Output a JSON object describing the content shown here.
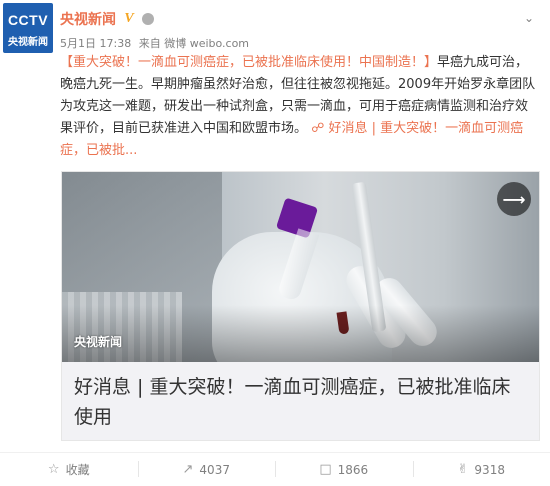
{
  "account": {
    "avatar_logo": "CCTV",
    "avatar_name": "央视新闻",
    "name": "央视新闻",
    "verified_mark": "V"
  },
  "meta": {
    "time": "5月1日 17:38",
    "source": "来自 微博 weibo.com"
  },
  "post": {
    "hashtag": "【重大突破！一滴血可测癌症，已被批准临床使用！中国制造！】",
    "body": "早癌九成可治，晚癌九死一生。早期肿瘤虽然好治愈，但往往被忽视拖延。2009年开始罗永章团队为攻克这一难题，研发出一种试剂盒，只需一滴血，可用于癌症病情监测和治疗效果评价，目前已获准进入中国和欧盟市场。",
    "link_text": "好消息 | 重大突破！一滴血可测癌症，已被批..."
  },
  "card": {
    "watermark": "央视新闻",
    "title": "好消息 | 重大突破！一滴血可测癌症，已被批准临床使用"
  },
  "actions": {
    "favorite_label": "收藏",
    "repost_count": "4037",
    "comment_count": "1866",
    "like_count": "9318"
  },
  "icons": {
    "verified": "verified-icon",
    "member": "member-icon",
    "menu": "chevron-down-icon",
    "video": "lightning-icon",
    "favorite": "star-icon",
    "repost": "repost-icon",
    "comment": "comment-icon",
    "like": "thumbs-up-icon",
    "link": "link-icon"
  },
  "colors": {
    "accent": "#eb7350",
    "text": "#333333",
    "muted": "#808080",
    "avatar_bg": "#1f5fb0"
  }
}
